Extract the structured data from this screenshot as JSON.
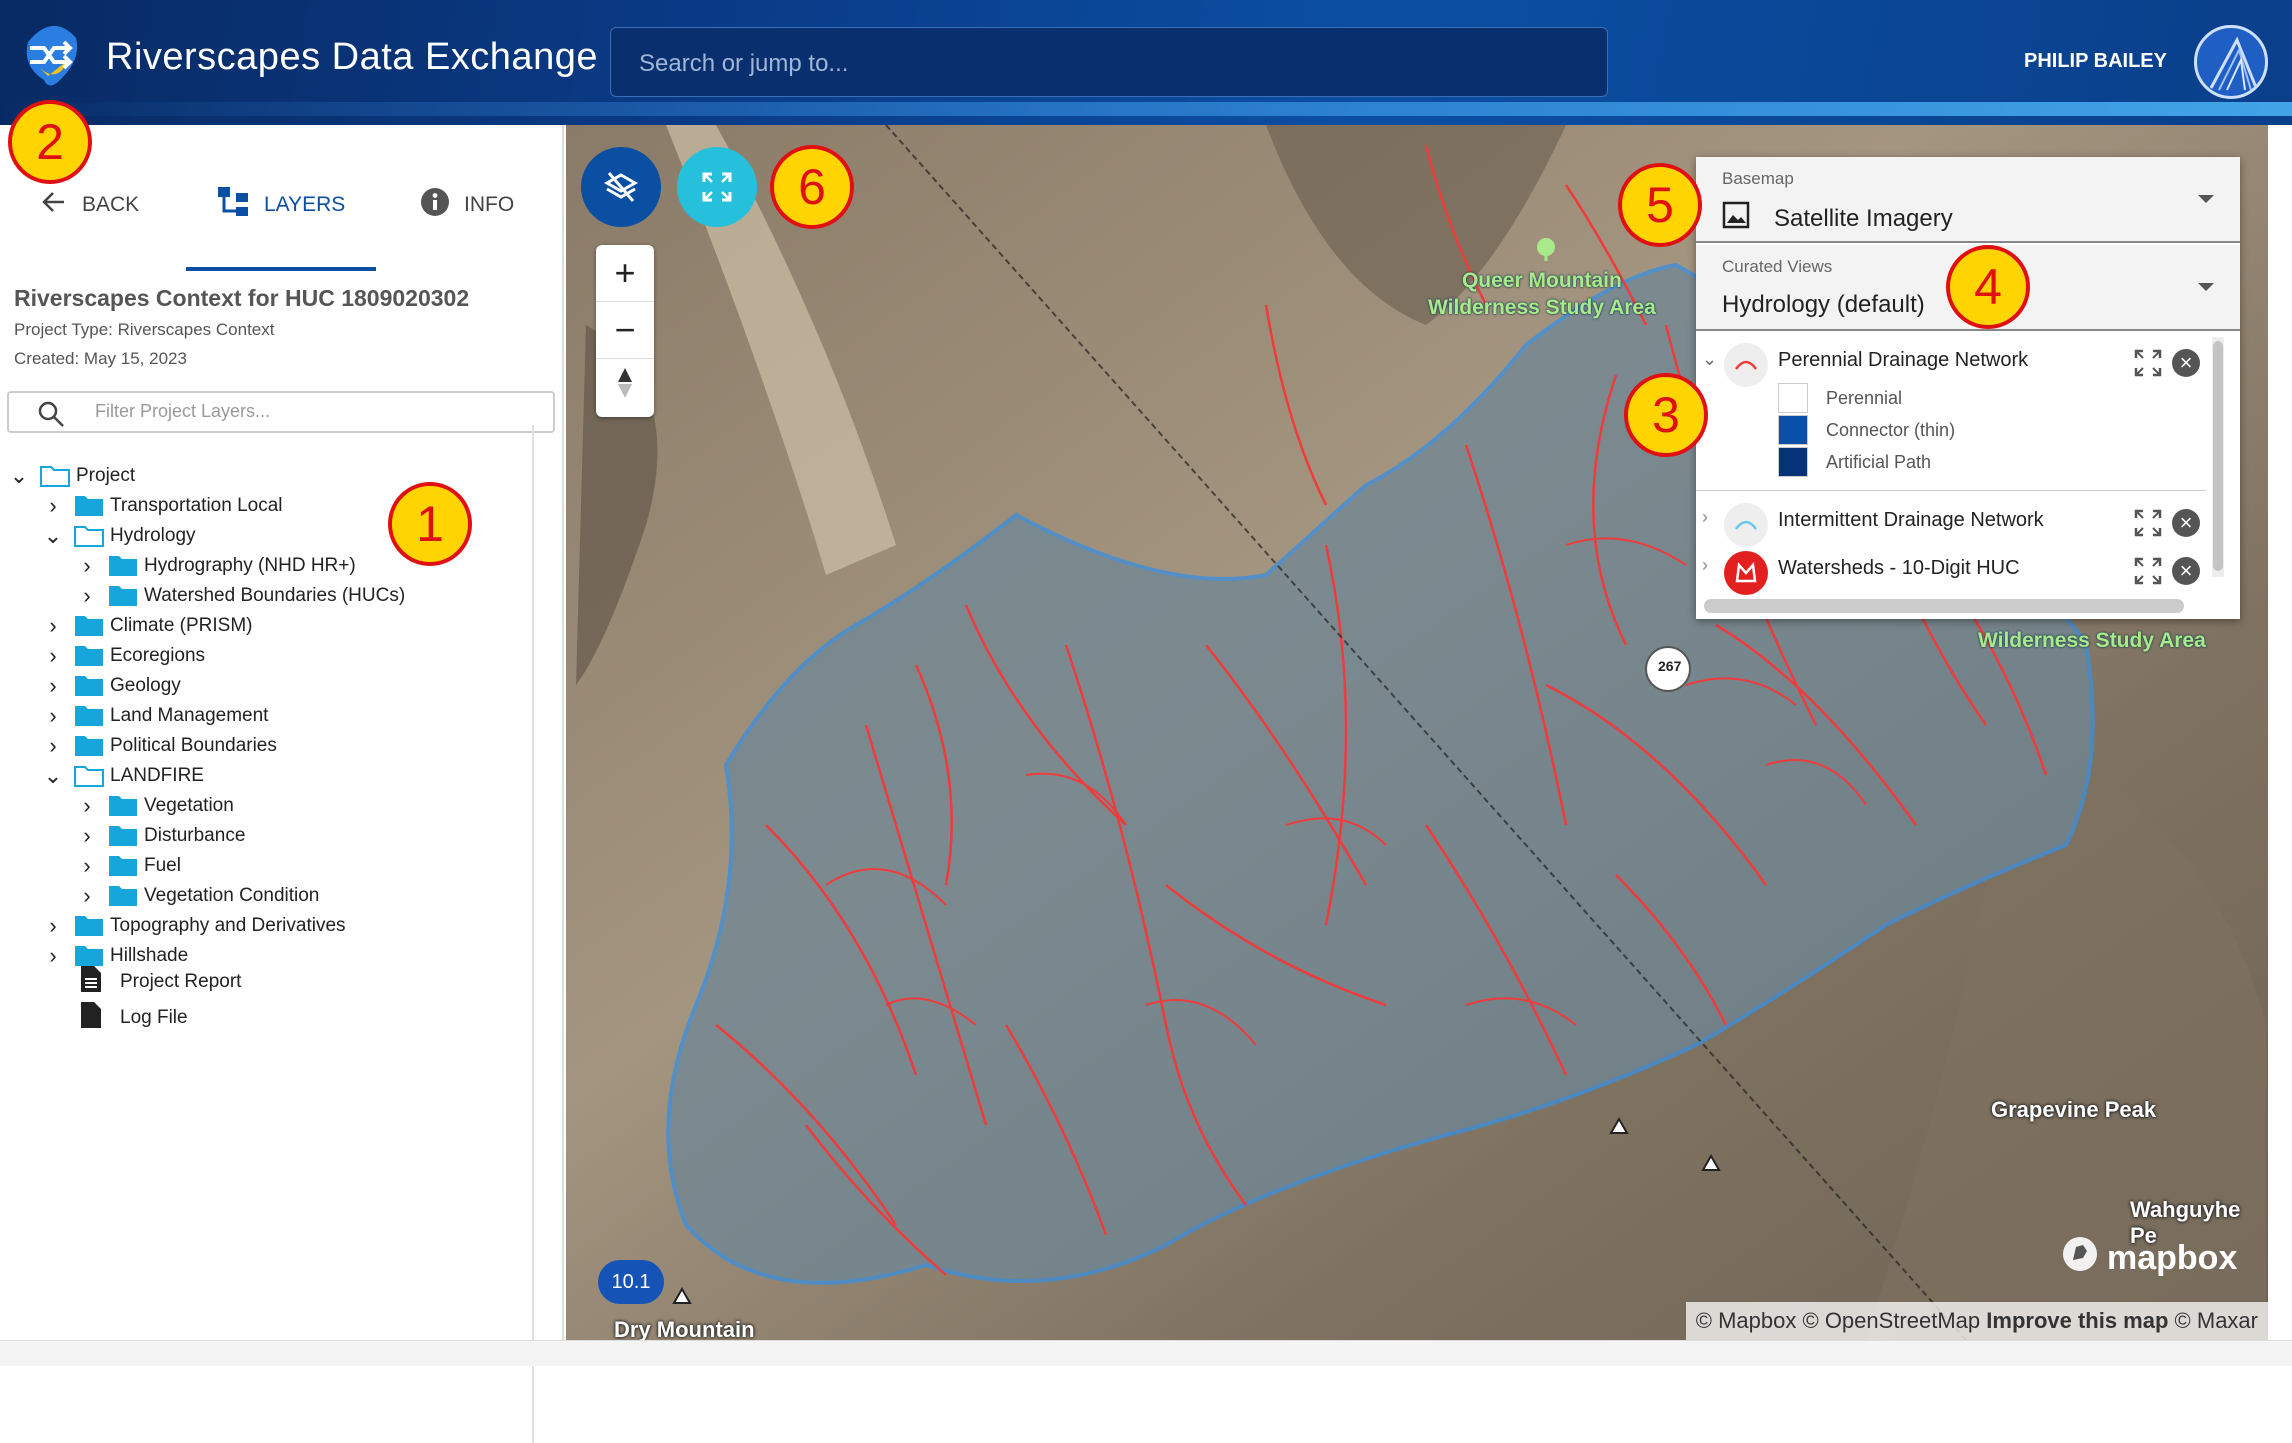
{
  "header": {
    "app_title": "Riverscapes Data Exchange",
    "search_placeholder": "Search or jump to...",
    "user_name": "PHILIP BAILEY"
  },
  "sidebar": {
    "tabs": [
      {
        "label": "BACK",
        "icon": "arrow-left-icon"
      },
      {
        "label": "LAYERS",
        "icon": "layers-tree-icon",
        "active": true
      },
      {
        "label": "INFO",
        "icon": "info-icon"
      }
    ],
    "project_title": "Riverscapes Context for HUC 1809020302",
    "project_type": "Project Type: Riverscapes Context",
    "created": "Created: May 15, 2023",
    "filter_placeholder": "Filter Project Layers...",
    "tree": [
      {
        "label": "Project",
        "expanded": true
      },
      {
        "label": "Transportation Local"
      },
      {
        "label": "Hydrology",
        "expanded": true
      },
      {
        "label": "Hydrography (NHD HR+)"
      },
      {
        "label": "Watershed Boundaries (HUCs)"
      },
      {
        "label": "Climate (PRISM)"
      },
      {
        "label": "Ecoregions"
      },
      {
        "label": "Geology"
      },
      {
        "label": "Land Management"
      },
      {
        "label": "Political Boundaries"
      },
      {
        "label": "LANDFIRE",
        "expanded": true
      },
      {
        "label": "Vegetation"
      },
      {
        "label": "Disturbance"
      },
      {
        "label": "Fuel"
      },
      {
        "label": "Vegetation Condition"
      },
      {
        "label": "Topography and Derivatives"
      },
      {
        "label": "Hillshade"
      },
      {
        "label": "Project Report"
      },
      {
        "label": "Log File"
      }
    ]
  },
  "map": {
    "zoom_level": "10.1",
    "labels": {
      "queer_mountain": "Queer Mountain\nWilderness Study Area",
      "wilderness": "Wilderness Study Area",
      "grapevine": "Grapevine Peak",
      "wahguyhe": "Wahguyhe Pe",
      "dry_mountain": "Dry Mountain",
      "route": "267"
    },
    "attribution": {
      "mapbox": "© Mapbox",
      "osm": "© OpenStreetMap",
      "improve": "Improve this map",
      "maxar": "© Maxar"
    },
    "brand": "mapbox",
    "colors": {
      "drainage": "#ef3b3b",
      "watershed": "#3a8fe0",
      "primary": "#0b4fa3",
      "cyan": "#26c0dc"
    }
  },
  "panel": {
    "basemap_label": "Basemap",
    "basemap_value": "Satellite Imagery",
    "views_label": "Curated Views",
    "views_value": "Hydrology (default)",
    "layers": [
      {
        "name": "Perennial Drainage Network",
        "expanded": true,
        "legend": [
          {
            "label": "Perennial",
            "color": "#ffffff"
          },
          {
            "label": "Connector (thin)",
            "color": "#0a4fa8"
          },
          {
            "label": "Artificial Path",
            "color": "#063377"
          }
        ]
      },
      {
        "name": "Intermittent Drainage Network"
      },
      {
        "name": "Watersheds - 10-Digit HUC"
      }
    ]
  },
  "callouts": [
    "1",
    "2",
    "3",
    "4",
    "5",
    "6"
  ]
}
